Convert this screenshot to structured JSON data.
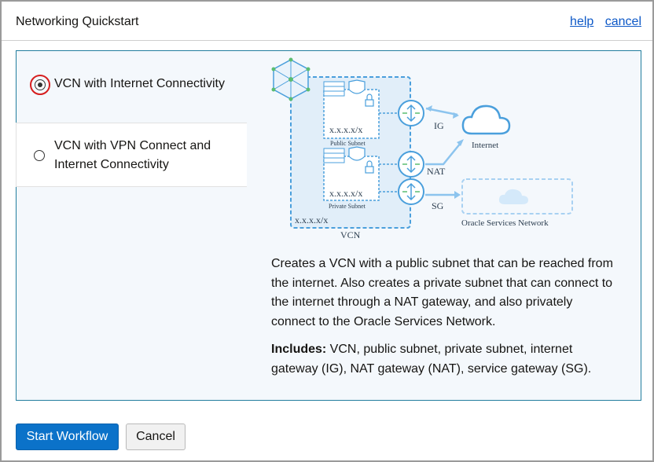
{
  "header": {
    "title": "Networking Quickstart",
    "help_label": "help",
    "cancel_label": "cancel"
  },
  "options": [
    {
      "label": "VCN with Internet Connectivity",
      "selected": true
    },
    {
      "label": "VCN with VPN Connect and Internet Connectivity",
      "selected": false
    }
  ],
  "diagram": {
    "public_subnet_cidr": "x.x.x.x/x",
    "public_subnet_label": "Public Subnet",
    "private_subnet_cidr": "x.x.x.x/x",
    "private_subnet_label": "Private Subnet",
    "vcn_cidr": "x.x.x.x/x",
    "vcn_label": "VCN",
    "ig_label": "IG",
    "nat_label": "NAT",
    "sg_label": "SG",
    "internet_label": "Internet",
    "osn_label": "Oracle Services Network"
  },
  "description": {
    "text": "Creates a VCN with a public subnet that can be reached from the internet. Also creates a private subnet that can connect to the internet through a NAT gateway, and also privately connect to the Oracle Services Network.",
    "includes_label": "Includes:",
    "includes_text": " VCN, public subnet, private subnet, internet gateway (IG), NAT gateway (NAT), service gateway (SG)."
  },
  "footer": {
    "start_label": "Start Workflow",
    "cancel_label": "Cancel"
  },
  "colors": {
    "accent": "#0b72c9",
    "panel_border": "#227e9e",
    "selected_ring": "#d61e1e",
    "diagram_blue": "#4a9fdc"
  }
}
